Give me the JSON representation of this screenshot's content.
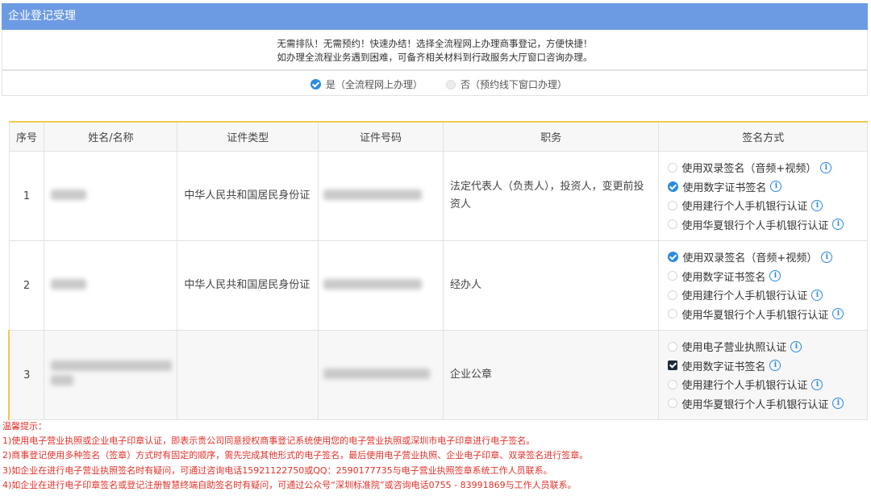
{
  "header": {
    "title": "企业登记受理"
  },
  "notice": {
    "line1": "无需排队！无需预约！快速办结！选择全流程网上办理商事登记，方便快捷！",
    "line2": "如办理全流程业务遇到困难，可备齐相关材料到行政服务大厅窗口咨询办理。"
  },
  "mode": {
    "yes_label": "是（全流程网上办理）",
    "no_label": "否（预约线下窗口办理）",
    "selected": "yes"
  },
  "table": {
    "headers": [
      "序号",
      "姓名/名称",
      "证件类型",
      "证件号码",
      "职务",
      "签名方式"
    ],
    "rows": [
      {
        "index": "1",
        "id_type": "中华人民共和国居民身份证",
        "duty": "法定代表人（负责人），投资人，变更前投资人",
        "sign_options": [
          {
            "label": "使用双录签名（音频+视频）",
            "state": "off"
          },
          {
            "label": "使用数字证书签名",
            "state": "selected"
          },
          {
            "label": "使用建行个人手机银行认证",
            "state": "off"
          },
          {
            "label": "使用华夏银行个人手机银行认证",
            "state": "off"
          }
        ]
      },
      {
        "index": "2",
        "id_type": "中华人民共和国居民身份证",
        "duty": "经办人",
        "sign_options": [
          {
            "label": "使用双录签名（音频+视频）",
            "state": "selected"
          },
          {
            "label": "使用数字证书签名",
            "state": "off"
          },
          {
            "label": "使用建行个人手机银行认证",
            "state": "off"
          },
          {
            "label": "使用华夏银行个人手机银行认证",
            "state": "off"
          }
        ]
      },
      {
        "index": "3",
        "id_type": "",
        "duty": "企业公章",
        "sign_options": [
          {
            "label": "使用电子营业执照认证",
            "state": "off"
          },
          {
            "label": "使用数字证书签名",
            "state": "checked"
          },
          {
            "label": "使用建行个人手机银行认证",
            "state": "off"
          },
          {
            "label": "使用华夏银行个人手机银行认证",
            "state": "off"
          }
        ]
      }
    ]
  },
  "tips": {
    "title": "温馨提示：",
    "items": [
      "1)使用电子营业执照或企业电子印章认证，即表示贵公司同意授权商事登记系统使用您的电子营业执照或深圳市电子印章进行电子签名。",
      "2)商事登记使用多种签名（签章）方式时有固定的顺序，需先完成其他形式的电子签名，最后使用电子营业执照、企业电子印章、双录签名进行签章。",
      "3)如企业在进行电子营业执照签名时有疑问，可通过咨询电话15921122750或QQ：2590177735与电子营业执照签章系统工作人员联系。",
      "4)如企业在进行电子印章签名或登记注册智慧终端自助签名时有疑问，可通过公众号“深圳标准院”或咨询电话0755 - 83991869与工作人员联系。"
    ]
  },
  "colors": {
    "header_bg": "#6d9be3",
    "accent": "#2b8ae2",
    "tip_red": "#e0312a",
    "table_top": "#f2c94c"
  }
}
